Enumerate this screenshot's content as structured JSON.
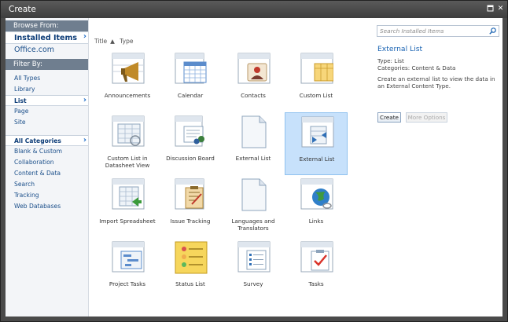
{
  "window": {
    "title": "Create"
  },
  "left": {
    "browse_heading": "Browse From:",
    "browse": [
      "Installed Items",
      "Office.com"
    ],
    "filter_heading": "Filter By:",
    "types": [
      "All Types",
      "Library",
      "List",
      "Page",
      "Site"
    ],
    "categories": [
      "All Categories",
      "Blank & Custom",
      "Collaboration",
      "Content & Data",
      "Search",
      "Tracking",
      "Web Databases"
    ]
  },
  "sort": {
    "title": "Title",
    "type": "Type"
  },
  "tiles": [
    "Announcements",
    "Calendar",
    "Contacts",
    "Custom List",
    "Custom List in Datasheet View",
    "Discussion Board",
    "External List",
    "External List",
    "Import Spreadsheet",
    "Issue Tracking",
    "Languages and Translators",
    "Links",
    "Project Tasks",
    "Status List",
    "Survey",
    "Tasks"
  ],
  "details": {
    "search_placeholder": "Search Installed Items",
    "name": "External List",
    "type": "Type: List",
    "categories": "Categories: Content & Data",
    "description": "Create an external list to view the data in an External Content Type.",
    "create_label": "Create",
    "more_label": "More Options"
  }
}
